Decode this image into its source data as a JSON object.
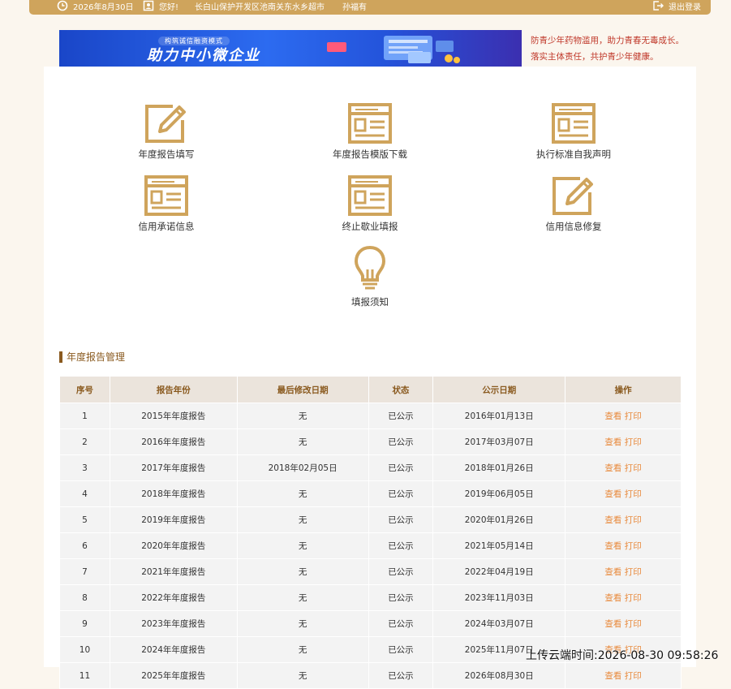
{
  "header": {
    "date": "2026年8月30日",
    "greeting": "您好!",
    "address": "长白山保护开发区池南关东水乡超市",
    "user": "孙福有",
    "logout_label": "退出登录"
  },
  "banner": {
    "small_text": "构筑诚信融资模式",
    "big_text": "助力中小微企业"
  },
  "notice": {
    "line1": "防青少年药物滥用，助力青春无毒成长。",
    "line2": "落实主体责任，共护青少年健康。"
  },
  "features": [
    {
      "label": "年度报告填写",
      "icon": "edit-form-icon"
    },
    {
      "label": "年度报告模版下载",
      "icon": "document-template-icon"
    },
    {
      "label": "执行标准自我声明",
      "icon": "document-template-icon"
    },
    {
      "label": "信用承诺信息",
      "icon": "document-template-icon"
    },
    {
      "label": "终止歇业填报",
      "icon": "document-template-icon"
    },
    {
      "label": "信用信息修复",
      "icon": "edit-form-icon"
    },
    {
      "label": "填报须知",
      "icon": "lightbulb-icon"
    }
  ],
  "report_section": {
    "title": "年度报告管理",
    "columns": [
      "序号",
      "报告年份",
      "最后修改日期",
      "状态",
      "公示日期",
      "操作"
    ],
    "view_label": "查看",
    "print_label": "打印",
    "rows": [
      {
        "no": "1",
        "year": "2015年年度报告",
        "modified": "无",
        "status": "已公示",
        "published": "2016年01月13日"
      },
      {
        "no": "2",
        "year": "2016年年度报告",
        "modified": "无",
        "status": "已公示",
        "published": "2017年03月07日"
      },
      {
        "no": "3",
        "year": "2017年年度报告",
        "modified": "2018年02月05日",
        "status": "已公示",
        "published": "2018年01月26日"
      },
      {
        "no": "4",
        "year": "2018年年度报告",
        "modified": "无",
        "status": "已公示",
        "published": "2019年06月05日"
      },
      {
        "no": "5",
        "year": "2019年年度报告",
        "modified": "无",
        "status": "已公示",
        "published": "2020年01月26日"
      },
      {
        "no": "6",
        "year": "2020年年度报告",
        "modified": "无",
        "status": "已公示",
        "published": "2021年05月14日"
      },
      {
        "no": "7",
        "year": "2021年年度报告",
        "modified": "无",
        "status": "已公示",
        "published": "2022年04月19日"
      },
      {
        "no": "8",
        "year": "2022年年度报告",
        "modified": "无",
        "status": "已公示",
        "published": "2023年11月03日"
      },
      {
        "no": "9",
        "year": "2023年年度报告",
        "modified": "无",
        "status": "已公示",
        "published": "2024年03月07日"
      },
      {
        "no": "10",
        "year": "2024年年度报告",
        "modified": "无",
        "status": "已公示",
        "published": "2025年11月07日"
      },
      {
        "no": "11",
        "year": "2025年年度报告",
        "modified": "无",
        "status": "已公示",
        "published": "2026年08月30日"
      }
    ]
  },
  "watermark": "上传云端时间:2026-08-30 09:58:26",
  "colors": {
    "accent": "#cfa45c",
    "header_text": "#8a5a1f",
    "action_link": "#e8893b",
    "notice": "#c0392b"
  }
}
